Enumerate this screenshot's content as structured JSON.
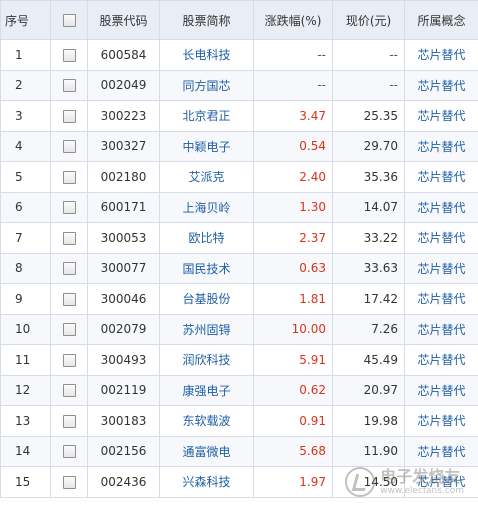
{
  "table": {
    "headers": {
      "index": "序号",
      "code": "股票代码",
      "name": "股票简称",
      "change": "涨跌幅(%)",
      "price": "现价(元)",
      "concept": "所属概念"
    },
    "rows": [
      {
        "index": "1",
        "code": "600584",
        "name": "长电科技",
        "change": "--",
        "price": "--",
        "concept": "芯片替代"
      },
      {
        "index": "2",
        "code": "002049",
        "name": "同方国芯",
        "change": "--",
        "price": "--",
        "concept": "芯片替代"
      },
      {
        "index": "3",
        "code": "300223",
        "name": "北京君正",
        "change": "3.47",
        "price": "25.35",
        "concept": "芯片替代"
      },
      {
        "index": "4",
        "code": "300327",
        "name": "中颖电子",
        "change": "0.54",
        "price": "29.70",
        "concept": "芯片替代"
      },
      {
        "index": "5",
        "code": "002180",
        "name": "艾派克",
        "change": "2.40",
        "price": "35.36",
        "concept": "芯片替代"
      },
      {
        "index": "6",
        "code": "600171",
        "name": "上海贝岭",
        "change": "1.30",
        "price": "14.07",
        "concept": "芯片替代"
      },
      {
        "index": "7",
        "code": "300053",
        "name": "欧比特",
        "change": "2.37",
        "price": "33.22",
        "concept": "芯片替代"
      },
      {
        "index": "8",
        "code": "300077",
        "name": "国民技术",
        "change": "0.63",
        "price": "33.63",
        "concept": "芯片替代"
      },
      {
        "index": "9",
        "code": "300046",
        "name": "台基股份",
        "change": "1.81",
        "price": "17.42",
        "concept": "芯片替代"
      },
      {
        "index": "10",
        "code": "002079",
        "name": "苏州固锝",
        "change": "10.00",
        "price": "7.26",
        "concept": "芯片替代"
      },
      {
        "index": "11",
        "code": "300493",
        "name": "润欣科技",
        "change": "5.91",
        "price": "45.49",
        "concept": "芯片替代"
      },
      {
        "index": "12",
        "code": "002119",
        "name": "康强电子",
        "change": "0.62",
        "price": "20.97",
        "concept": "芯片替代"
      },
      {
        "index": "13",
        "code": "300183",
        "name": "东软载波",
        "change": "0.91",
        "price": "19.98",
        "concept": "芯片替代"
      },
      {
        "index": "14",
        "code": "002156",
        "name": "通富微电",
        "change": "5.68",
        "price": "11.90",
        "concept": "芯片替代"
      },
      {
        "index": "15",
        "code": "002436",
        "name": "兴森科技",
        "change": "1.97",
        "price": "14.50",
        "concept": "芯片替代"
      }
    ]
  },
  "watermark": {
    "main": "电子发烧友",
    "sub": "www.elecfans.com"
  },
  "colors": {
    "header_bg": "#e9eef6",
    "link": "#1f5fa8",
    "up": "#d9341c",
    "border": "#d6dde8"
  }
}
